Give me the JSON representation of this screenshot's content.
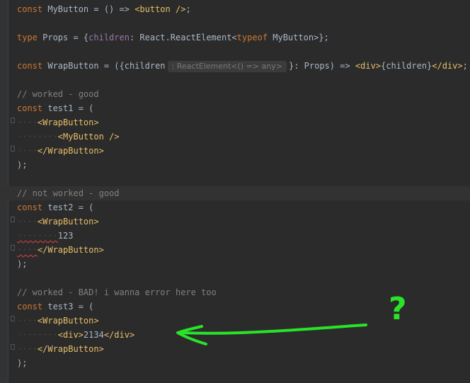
{
  "annotation": {
    "color": "#29e329",
    "question_mark": "?"
  },
  "code": {
    "l1": {
      "kw": "const ",
      "name": "MyButton",
      "rest1": " = () => ",
      "tag": "<button />",
      "end": ";"
    },
    "l3": {
      "kw": "type ",
      "name": "Props = {",
      "prop": "children",
      "rest": ": React.ReactElement<",
      "kw2": "typeof ",
      "name2": "MyButton",
      "end": ">};"
    },
    "l5": {
      "kw": "const ",
      "name": "WrapButton",
      "rest1": " = ({children",
      "hint": ": ReactElement<() => any>",
      "rest2": "}: Props) => ",
      "tag1": "<div>",
      "inner": "{children}",
      "tag2": "</div>",
      "end": ";"
    },
    "l7": {
      "comment": "// worked - good"
    },
    "l8": {
      "kw": "const ",
      "name": "test1 = ("
    },
    "l9": {
      "ws": "····",
      "tag": "<WrapButton>"
    },
    "l10": {
      "ws": "········",
      "tag": "<MyButton />"
    },
    "l11": {
      "ws": "····",
      "tag": "</WrapButton>"
    },
    "l12": {
      "text": ");"
    },
    "l14": {
      "comment": "// not worked - good"
    },
    "l15": {
      "kw": "const ",
      "name": "test2 = ("
    },
    "l16": {
      "ws": "····",
      "tag": "<WrapButton>"
    },
    "l17": {
      "ws": "········",
      "num": "123"
    },
    "l18": {
      "ws": "····",
      "tag": "</WrapButton>"
    },
    "l19": {
      "text": ");"
    },
    "l21": {
      "comment": "// worked - BAD! i wanna error here too"
    },
    "l22": {
      "kw": "const ",
      "name": "test3 = ("
    },
    "l23": {
      "ws": "····",
      "tag": "<WrapButton>"
    },
    "l24": {
      "ws": "········",
      "tag1": "<div>",
      "inner": "2134",
      "tag2": "</div>"
    },
    "l25": {
      "ws": "····",
      "tag": "</WrapButton>"
    },
    "l26": {
      "text": ");"
    }
  }
}
